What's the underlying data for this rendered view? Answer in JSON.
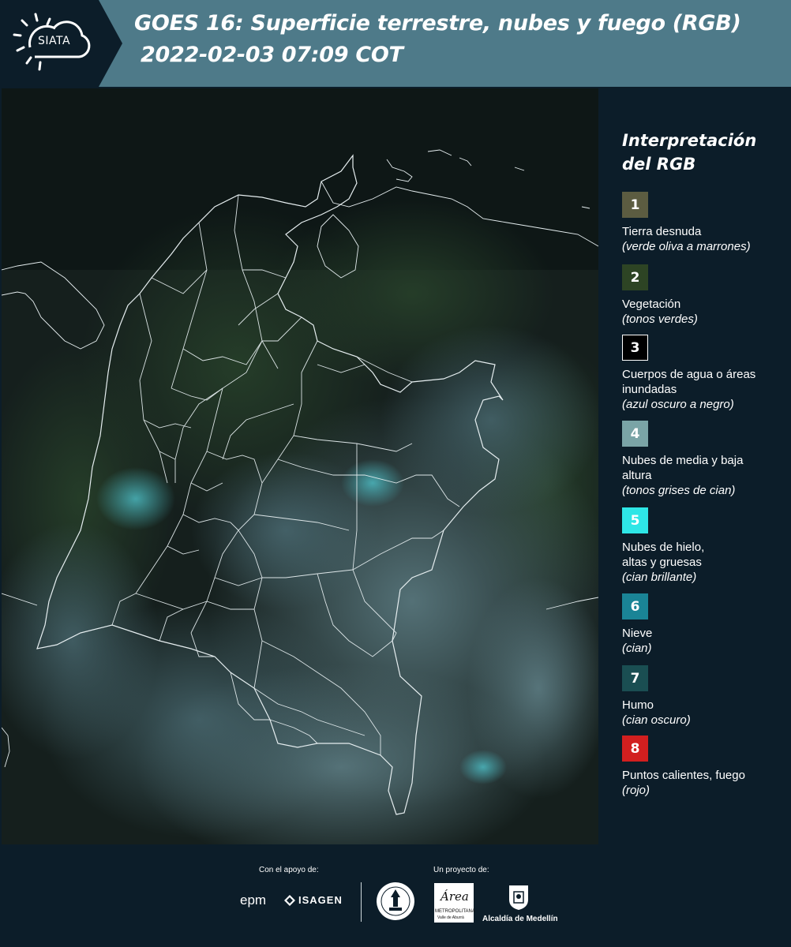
{
  "header": {
    "logo_text": "SIATA",
    "title_line1": "GOES 16: Superficie terrestre, nubes y fuego (RGB)",
    "title_line2": "2022-02-03 07:09 COT"
  },
  "legend": {
    "title_line1": "Interpretación",
    "title_line2": "del RGB",
    "items": [
      {
        "number": "1",
        "label": "Tierra desnuda",
        "note": "(verde oliva a marrones)",
        "color": "#5c5c41"
      },
      {
        "number": "2",
        "label": "Vegetación",
        "note": "(tonos verdes)",
        "color": "#2d4424"
      },
      {
        "number": "3",
        "label": "Cuerpos de agua o áreas inundadas",
        "note": "(azul oscuro a negro)",
        "color": "#000000"
      },
      {
        "number": "4",
        "label": "Nubes de media y baja altura",
        "note": "(tonos grises de cian)",
        "color": "#7aa4a6"
      },
      {
        "number": "5",
        "label": "Nubes de hielo, altas y gruesas",
        "note": "(cian brillante)",
        "color": "#2ee6e6"
      },
      {
        "number": "6",
        "label": "Nieve",
        "note": "(cian)",
        "color": "#1a8496"
      },
      {
        "number": "7",
        "label": "Humo",
        "note": "(cian oscuro)",
        "color": "#1a4e52"
      },
      {
        "number": "8",
        "label": "Puntos calientes, fuego",
        "note": "(rojo)",
        "color": "#d21f1f"
      }
    ]
  },
  "footer": {
    "support_caption": "Con el apoyo de:",
    "project_caption": "Un proyecto de:",
    "epm": "epm",
    "isagen": "ISAGEN",
    "area_metro_line1": "Área",
    "area_metro_line2": "METROPOLITANA",
    "area_metro_line3": "Valle de Aburrá",
    "alcaldia": "Alcaldía de Medellín"
  },
  "colors": {
    "header_bg": "#4e7a89",
    "page_bg": "#0c1d29",
    "logo_bg": "#0c1d29"
  }
}
